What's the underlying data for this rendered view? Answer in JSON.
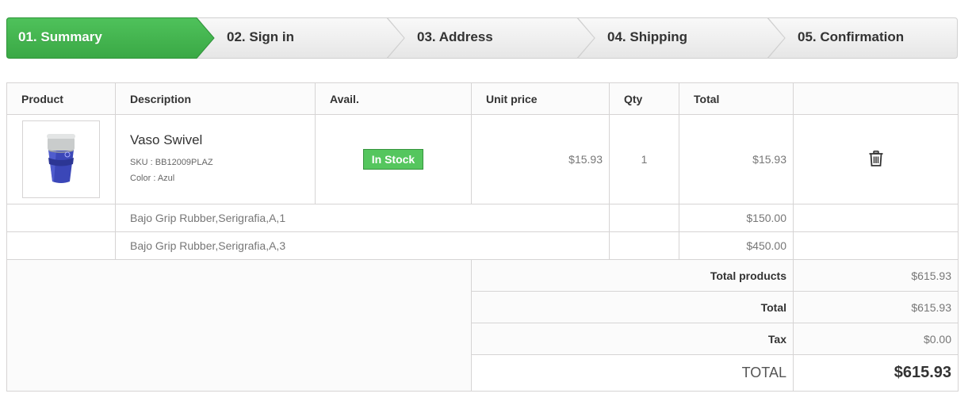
{
  "steps": [
    {
      "label": "01. Summary",
      "active": true
    },
    {
      "label": "02. Sign in",
      "active": false
    },
    {
      "label": "03. Address",
      "active": false
    },
    {
      "label": "04. Shipping",
      "active": false
    },
    {
      "label": "05. Confirmation",
      "active": false
    }
  ],
  "table": {
    "headers": {
      "product": "Product",
      "description": "Description",
      "avail": "Avail.",
      "unit_price": "Unit price",
      "qty": "Qty",
      "total": "Total"
    },
    "product": {
      "image_icon": "tumbler-cup-icon",
      "name": "Vaso Swivel",
      "sku": "SKU : BB12009PLAZ",
      "color": "Color : Azul",
      "availability": "In Stock",
      "unit_price": "$15.93",
      "qty": "1",
      "total": "$15.93",
      "delete_icon": "trash-icon"
    },
    "extras": [
      {
        "description": "Bajo Grip Rubber,Serigrafia,A,1",
        "total": "$150.00"
      },
      {
        "description": "Bajo Grip Rubber,Serigrafia,A,3",
        "total": "$450.00"
      }
    ],
    "summary": {
      "total_products_label": "Total products",
      "total_products_value": "$615.93",
      "total_label": "Total",
      "total_value": "$615.93",
      "tax_label": "Tax",
      "tax_value": "$0.00",
      "grand_total_label": "TOTAL",
      "grand_total_value": "$615.93"
    }
  },
  "colors": {
    "active_step": "#46b852",
    "stock_badge": "#55c65e",
    "border": "#d6d4d4"
  }
}
